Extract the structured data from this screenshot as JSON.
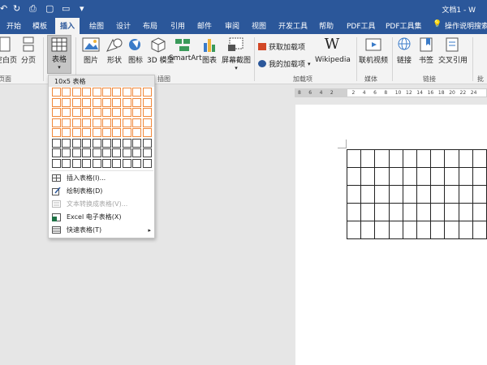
{
  "titlebar": {
    "doc_title": "文档1 - W",
    "qat": [
      {
        "icon": "undo-icon",
        "glyph": "↶"
      },
      {
        "icon": "redo-icon",
        "glyph": "↻"
      },
      {
        "icon": "print-preview-icon",
        "glyph": "⎙"
      },
      {
        "icon": "new-document-icon",
        "glyph": "▢"
      },
      {
        "icon": "open-folder-icon",
        "glyph": "▭"
      },
      {
        "icon": "customize-qat-icon",
        "glyph": "▾"
      }
    ]
  },
  "tabs": [
    "开始",
    "模板",
    "插入",
    "绘图",
    "设计",
    "布局",
    "引用",
    "邮件",
    "审阅",
    "视图",
    "开发工具",
    "帮助",
    "PDF工具",
    "PDF工具集",
    "操作说明搜索"
  ],
  "active_tab": "插入",
  "ribbon": {
    "blank_page": "空白页",
    "page_break": "分页",
    "pages_group": "页面",
    "table": "表格",
    "picture": "图片",
    "shapes": "形状",
    "icons": "图标",
    "models_3d": "3D 模型",
    "smartart": "SmartArt",
    "chart": "图表",
    "screenshot": "屏幕截图",
    "illustrations_group": "插图",
    "get_addins": "获取加载项",
    "my_addins": "我的加载项",
    "wikipedia": "Wikipedia",
    "addins_group": "加载项",
    "online_video": "联机视频",
    "media_group": "媒体",
    "link": "链接",
    "bookmark": "书签",
    "cross_ref": "交叉引用",
    "links_group": "链接",
    "comments_group": "批"
  },
  "dropdown": {
    "header": "10x5 表格",
    "grid_cols": 10,
    "grid_rows": 8,
    "selected_cols": 10,
    "selected_rows": 5,
    "items": [
      {
        "label": "插入表格(I)...",
        "icon": "insert-table-icon",
        "disabled": false
      },
      {
        "label": "绘制表格(D)",
        "icon": "draw-table-icon",
        "disabled": false
      },
      {
        "label": "文本转换成表格(V)...",
        "icon": "text-to-table-icon",
        "disabled": true
      },
      {
        "label": "Excel 电子表格(X)",
        "icon": "excel-spreadsheet-icon",
        "disabled": false
      },
      {
        "label": "快速表格(T)",
        "icon": "quick-tables-icon",
        "disabled": false
      }
    ],
    "submenu_arrow": "▸"
  },
  "ruler": {
    "labels": [
      "8",
      "6",
      "4",
      "2",
      "",
      "2",
      "4",
      "6",
      "8",
      "10",
      "12",
      "14",
      "16",
      "18",
      "20",
      "22",
      "24"
    ]
  },
  "document": {
    "table_rows": 5,
    "table_cols": 10
  },
  "colors": {
    "accent": "#2b579a",
    "grid_highlight": "#f0883a"
  }
}
